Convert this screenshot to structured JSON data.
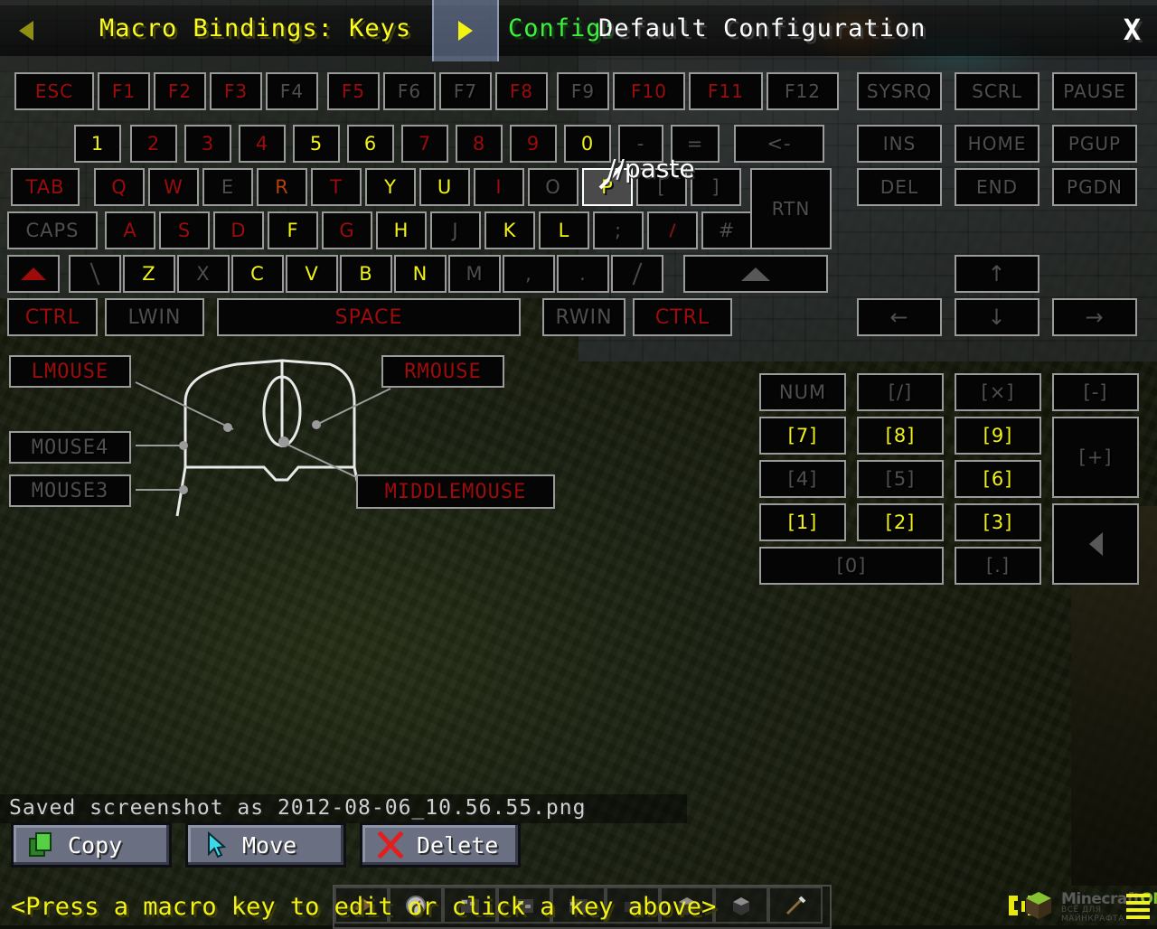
{
  "window": {
    "title": "Macro Bindings: Keys",
    "config_label": "Config:",
    "config_value": "Default Configuration",
    "close": "X",
    "back_arrow": "back-arrow",
    "forward_arrow": "forward-arrow"
  },
  "tooltip": {
    "text": "//paste",
    "for_key": "P"
  },
  "colors": {
    "bound_red": "#9e0b0b",
    "bound_orange": "#b4400c",
    "bound_yellow": "#f2f216",
    "unbound_gray": "#4e4e4e",
    "key_border": "#9a9a9a",
    "key_fill": "#050505",
    "title_yellow": "#fcfc20",
    "config_green": "#3ff03f",
    "status_yellow": "#f2f216"
  },
  "keyboard": {
    "row_function": [
      {
        "label": "ESC",
        "state": "red"
      },
      {
        "label": "F1",
        "state": "red"
      },
      {
        "label": "F2",
        "state": "red"
      },
      {
        "label": "F3",
        "state": "red"
      },
      {
        "label": "F4",
        "state": "gray"
      },
      {
        "label": "F5",
        "state": "red"
      },
      {
        "label": "F6",
        "state": "gray"
      },
      {
        "label": "F7",
        "state": "gray"
      },
      {
        "label": "F8",
        "state": "red"
      },
      {
        "label": "F9",
        "state": "gray"
      },
      {
        "label": "F10",
        "state": "red"
      },
      {
        "label": "F11",
        "state": "red"
      },
      {
        "label": "F12",
        "state": "gray"
      },
      {
        "label": "SYSRQ",
        "state": "gray"
      },
      {
        "label": "SCRL",
        "state": "gray"
      },
      {
        "label": "PAUSE",
        "state": "gray"
      }
    ],
    "row_number": [
      {
        "label": "1",
        "state": "yellow"
      },
      {
        "label": "2",
        "state": "red"
      },
      {
        "label": "3",
        "state": "red"
      },
      {
        "label": "4",
        "state": "red"
      },
      {
        "label": "5",
        "state": "yellow"
      },
      {
        "label": "6",
        "state": "yellow"
      },
      {
        "label": "7",
        "state": "red"
      },
      {
        "label": "8",
        "state": "red"
      },
      {
        "label": "9",
        "state": "red"
      },
      {
        "label": "0",
        "state": "yellow"
      },
      {
        "label": "-",
        "state": "gray"
      },
      {
        "label": "=",
        "state": "gray"
      },
      {
        "label": "<-",
        "state": "gray"
      }
    ],
    "row_number_nav": [
      {
        "label": "INS",
        "state": "gray"
      },
      {
        "label": "HOME",
        "state": "gray"
      },
      {
        "label": "PGUP",
        "state": "gray"
      }
    ],
    "row_qwerty": [
      {
        "label": "TAB",
        "state": "red"
      },
      {
        "label": "Q",
        "state": "red"
      },
      {
        "label": "W",
        "state": "red"
      },
      {
        "label": "E",
        "state": "gray"
      },
      {
        "label": "R",
        "state": "orange"
      },
      {
        "label": "T",
        "state": "red"
      },
      {
        "label": "Y",
        "state": "yellow"
      },
      {
        "label": "U",
        "state": "yellow"
      },
      {
        "label": "I",
        "state": "red"
      },
      {
        "label": "O",
        "state": "gray"
      },
      {
        "label": "P",
        "state": "yellow",
        "hover": true
      },
      {
        "label": "[",
        "state": "gray"
      },
      {
        "label": "]",
        "state": "gray"
      },
      {
        "label": "RTN",
        "state": "gray"
      }
    ],
    "row_qwerty_nav": [
      {
        "label": "DEL",
        "state": "gray"
      },
      {
        "label": "END",
        "state": "gray"
      },
      {
        "label": "PGDN",
        "state": "gray"
      }
    ],
    "row_asdf": [
      {
        "label": "CAPS",
        "state": "gray"
      },
      {
        "label": "A",
        "state": "red"
      },
      {
        "label": "S",
        "state": "red"
      },
      {
        "label": "D",
        "state": "red"
      },
      {
        "label": "F",
        "state": "yellow"
      },
      {
        "label": "G",
        "state": "red"
      },
      {
        "label": "H",
        "state": "yellow"
      },
      {
        "label": "J",
        "state": "gray"
      },
      {
        "label": "K",
        "state": "yellow"
      },
      {
        "label": "L",
        "state": "yellow"
      },
      {
        "label": ";",
        "state": "gray"
      },
      {
        "label": "`",
        "state": "red"
      },
      {
        "label": "#",
        "state": "gray"
      }
    ],
    "row_zxcv": [
      {
        "label": "LSHIFT",
        "glyph": "shift-triangle",
        "state": "red"
      },
      {
        "label": "\\",
        "state": "gray"
      },
      {
        "label": "Z",
        "state": "yellow"
      },
      {
        "label": "X",
        "state": "gray"
      },
      {
        "label": "C",
        "state": "yellow"
      },
      {
        "label": "V",
        "state": "yellow"
      },
      {
        "label": "B",
        "state": "yellow"
      },
      {
        "label": "N",
        "state": "yellow"
      },
      {
        "label": "M",
        "state": "gray"
      },
      {
        "label": ",",
        "state": "gray"
      },
      {
        "label": ".",
        "state": "gray"
      },
      {
        "label": "/",
        "state": "gray"
      },
      {
        "label": "RSHIFT",
        "glyph": "shift-triangle",
        "state": "gray"
      }
    ],
    "row_bottom": [
      {
        "label": "CTRL",
        "state": "red"
      },
      {
        "label": "LWIN",
        "state": "gray"
      },
      {
        "label": "SPACE",
        "state": "red"
      },
      {
        "label": "RWIN",
        "state": "gray"
      },
      {
        "label": "CTRL",
        "state": "red"
      }
    ],
    "arrows": [
      {
        "label": "↑",
        "state": "gray",
        "name": "arrow-up"
      },
      {
        "label": "←",
        "state": "gray",
        "name": "arrow-left"
      },
      {
        "label": "↓",
        "state": "gray",
        "name": "arrow-down"
      },
      {
        "label": "→",
        "state": "gray",
        "name": "arrow-right"
      }
    ],
    "numpad": [
      {
        "label": "NUM",
        "state": "gray"
      },
      {
        "label": "[/]",
        "state": "gray"
      },
      {
        "label": "[×]",
        "state": "gray"
      },
      {
        "label": "[-]",
        "state": "gray"
      },
      {
        "label": "[7]",
        "state": "yellow"
      },
      {
        "label": "[8]",
        "state": "yellow"
      },
      {
        "label": "[9]",
        "state": "yellow"
      },
      {
        "label": "[+]",
        "state": "gray"
      },
      {
        "label": "[4]",
        "state": "gray"
      },
      {
        "label": "[5]",
        "state": "gray"
      },
      {
        "label": "[6]",
        "state": "yellow"
      },
      {
        "label": "[1]",
        "state": "yellow"
      },
      {
        "label": "[2]",
        "state": "yellow"
      },
      {
        "label": "[3]",
        "state": "yellow"
      },
      {
        "label": "[0]",
        "state": "gray"
      },
      {
        "label": "[.]",
        "state": "gray"
      },
      {
        "label": "[ENTER]",
        "glyph": "enter-triangle",
        "state": "gray"
      }
    ]
  },
  "mouse": {
    "labels": [
      {
        "label": "LMOUSE",
        "state": "red"
      },
      {
        "label": "RMOUSE",
        "state": "red"
      },
      {
        "label": "MOUSE4",
        "state": "gray"
      },
      {
        "label": "MOUSE3",
        "state": "gray"
      },
      {
        "label": "MIDDLEMOUSE",
        "state": "red"
      }
    ]
  },
  "footer": {
    "saved_message": "Saved screenshot as 2012-08-06_10.56.55.png",
    "buttons": [
      {
        "label": "Copy",
        "icon": "copy-icon"
      },
      {
        "label": "Move",
        "icon": "cursor-icon"
      },
      {
        "label": "Delete",
        "icon": "x-icon"
      }
    ],
    "status": "<Press a macro key to edit or click a key above>"
  },
  "watermark": {
    "brand_dark": "Minecraft",
    "brand_light": "OM",
    "subtitle": "ВСЁ ДЛЯ МАЙНКРАФТА"
  }
}
